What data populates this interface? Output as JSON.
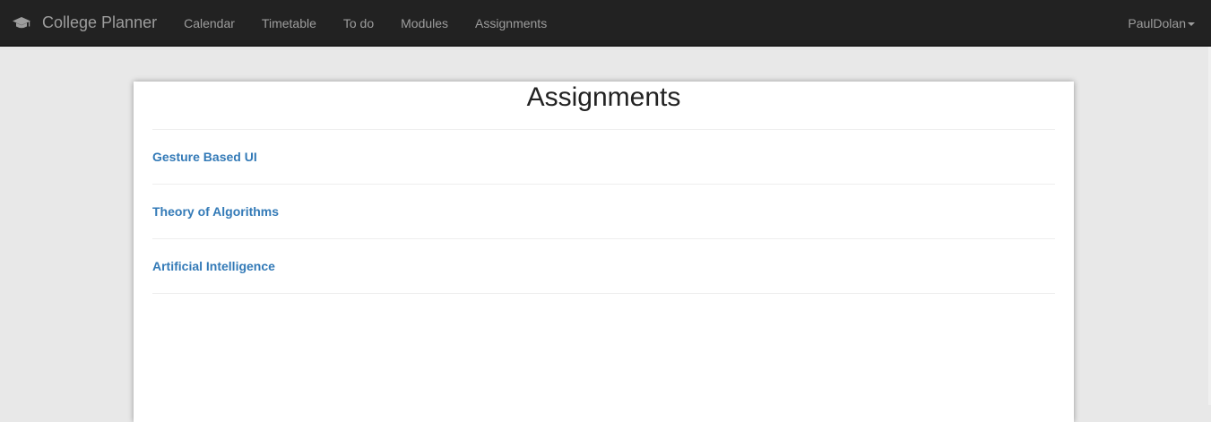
{
  "app": {
    "brand_name": "College Planner",
    "brand_icon": "graduation-cap-icon"
  },
  "nav": {
    "items": [
      {
        "label": "Calendar"
      },
      {
        "label": "Timetable"
      },
      {
        "label": "To do"
      },
      {
        "label": "Modules"
      },
      {
        "label": "Assignments"
      }
    ]
  },
  "user": {
    "name": "PaulDolan"
  },
  "main": {
    "title": "Assignments",
    "assignments": [
      {
        "label": "Gesture Based UI"
      },
      {
        "label": "Theory of Algorithms"
      },
      {
        "label": "Artificial Intelligence"
      }
    ]
  },
  "colors": {
    "navbar_bg": "#222222",
    "nav_text": "#9d9d9d",
    "link": "#337ab7",
    "page_bg": "#e8e8e8"
  }
}
